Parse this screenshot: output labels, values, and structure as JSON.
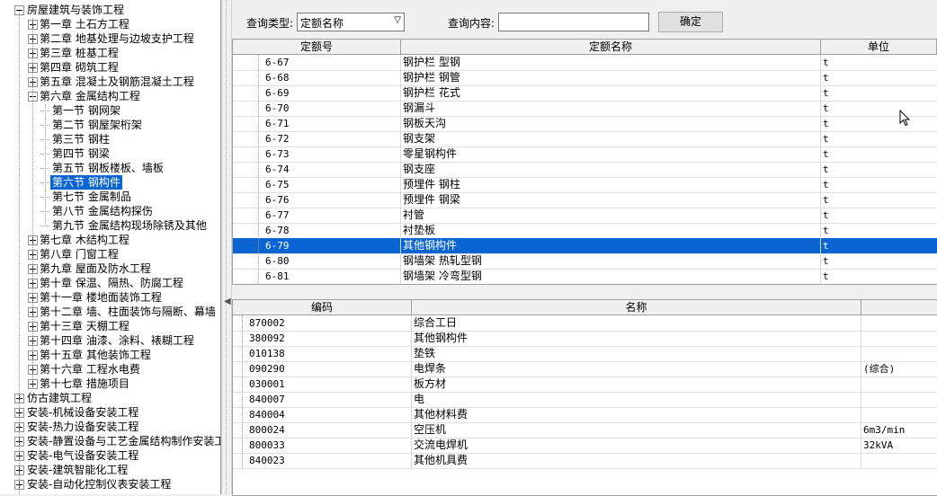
{
  "tree": [
    {
      "label": "房屋建筑与装饰工程",
      "level": 0,
      "expanded": true
    },
    {
      "label": "第一章  土石方工程",
      "level": 1
    },
    {
      "label": "第二章  地基处理与边坡支护工程",
      "level": 1
    },
    {
      "label": "第三章  桩基工程",
      "level": 1
    },
    {
      "label": "第四章  砌筑工程",
      "level": 1
    },
    {
      "label": "第五章  混凝土及钢筋混凝土工程",
      "level": 1
    },
    {
      "label": "第六章  金属结构工程",
      "level": 1,
      "expanded": true
    },
    {
      "label": "第一节  钢网架",
      "level": 2
    },
    {
      "label": "第二节  钢屋架桁架",
      "level": 2
    },
    {
      "label": "第三节  钢柱",
      "level": 2
    },
    {
      "label": "第四节  钢梁",
      "level": 2
    },
    {
      "label": "第五节  钢板楼板、墙板",
      "level": 2
    },
    {
      "label": "第六节  钢构件",
      "level": 2,
      "selected": true
    },
    {
      "label": "第七节  金属制品",
      "level": 2
    },
    {
      "label": "第八节  金属结构探伤",
      "level": 2
    },
    {
      "label": "第九节  金属结构现场除锈及其他",
      "level": 2
    },
    {
      "label": "第七章  木结构工程",
      "level": 1
    },
    {
      "label": "第八章  门窗工程",
      "level": 1
    },
    {
      "label": "第九章  屋面及防水工程",
      "level": 1
    },
    {
      "label": "第十章  保温、隔热、防腐工程",
      "level": 1
    },
    {
      "label": "第十一章  楼地面装饰工程",
      "level": 1
    },
    {
      "label": "第十二章  墙、柱面装饰与隔断、幕墙",
      "level": 1
    },
    {
      "label": "第十三章  天棚工程",
      "level": 1
    },
    {
      "label": "第十四章  油漆、涂料、裱糊工程",
      "level": 1
    },
    {
      "label": "第十五章  其他装饰工程",
      "level": 1
    },
    {
      "label": "第十六章  工程水电费",
      "level": 1
    },
    {
      "label": "第十七章  措施项目",
      "level": 1
    },
    {
      "label": "仿古建筑工程",
      "level": 0
    },
    {
      "label": "安装-机械设备安装工程",
      "level": 0
    },
    {
      "label": "安装-热力设备安装工程",
      "level": 0
    },
    {
      "label": "安装-静置设备与工艺金属结构制作安装工",
      "level": 0
    },
    {
      "label": "安装-电气设备安装工程",
      "level": 0
    },
    {
      "label": "安装-建筑智能化工程",
      "level": 0
    },
    {
      "label": "安装-自动化控制仪表安装工程",
      "level": 0
    }
  ],
  "query": {
    "type_label": "查询类型:",
    "type_value": "定额名称",
    "content_label": "查询内容:",
    "content_value": "",
    "confirm_label": "确定"
  },
  "quota_table": {
    "headers": [
      "定额号",
      "定额名称",
      "单位"
    ],
    "rows": [
      [
        "6-67",
        "钢护栏  型钢",
        "t"
      ],
      [
        "6-68",
        "钢护栏  钢管",
        "t"
      ],
      [
        "6-69",
        "钢护栏  花式",
        "t"
      ],
      [
        "6-70",
        "钢漏斗",
        "t"
      ],
      [
        "6-71",
        "钢板天沟",
        "t"
      ],
      [
        "6-72",
        "钢支架",
        "t"
      ],
      [
        "6-73",
        "零星钢构件",
        "t"
      ],
      [
        "6-74",
        "钢支座",
        "t"
      ],
      [
        "6-75",
        "预埋件  钢柱",
        "t"
      ],
      [
        "6-76",
        "预埋件  钢梁",
        "t"
      ],
      [
        "6-77",
        "衬管",
        "t"
      ],
      [
        "6-78",
        "衬垫板",
        "t"
      ],
      [
        "6-79",
        "其他钢构件",
        "t"
      ],
      [
        "6-80",
        "钢墙架  热轧型钢",
        "t"
      ],
      [
        "6-81",
        "钢墙架  冷弯型钢",
        "t"
      ]
    ],
    "selected_index": 12
  },
  "resource_table": {
    "headers": [
      "编码",
      "名称",
      ""
    ],
    "rows": [
      [
        "870002",
        "综合工日",
        ""
      ],
      [
        "380092",
        "其他钢构件",
        ""
      ],
      [
        "010138",
        "垫铁",
        ""
      ],
      [
        "090290",
        "电焊条",
        "(综合)"
      ],
      [
        "030001",
        "板方材",
        ""
      ],
      [
        "840007",
        "电",
        ""
      ],
      [
        "840004",
        "其他材料费",
        ""
      ],
      [
        "800024",
        "空压机",
        "6m3/min"
      ],
      [
        "800033",
        "交流电焊机",
        "32kVA"
      ],
      [
        "840023",
        "其他机具费",
        ""
      ]
    ]
  }
}
